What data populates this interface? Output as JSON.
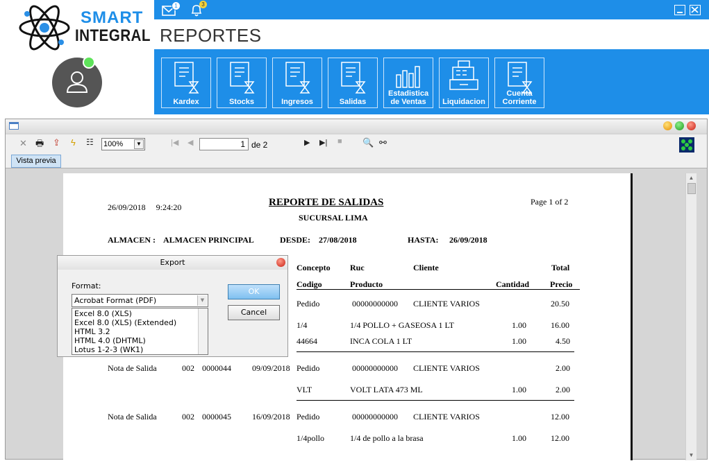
{
  "app": {
    "logo_line1": "SMART",
    "logo_line2": "INTEGRAL",
    "page_title": "REPORTES",
    "mail_count": "1",
    "notif_count": "3",
    "accent": "#1e8ee8"
  },
  "ribbon": [
    {
      "label": "Kardex",
      "icon": "document-hourglass-icon"
    },
    {
      "label": "Stocks",
      "icon": "document-hourglass-icon"
    },
    {
      "label": "Ingresos",
      "icon": "document-hourglass-icon"
    },
    {
      "label": "Salidas",
      "icon": "document-hourglass-icon"
    },
    {
      "label": "Estadistica de Ventas",
      "icon": "bar-chart-icon"
    },
    {
      "label": "Liquidacion",
      "icon": "cash-register-icon"
    },
    {
      "label": "Cuenta Corriente",
      "icon": "document-hourglass-icon"
    }
  ],
  "viewer": {
    "zoom": "100%",
    "page_current": "1",
    "page_of": "de 2",
    "tab_label": "Vista previa"
  },
  "report": {
    "datetime": "26/09/2018     9:24:20",
    "title": "REPORTE DE SALIDAS",
    "subtitle": "SUCURSAL LIMA",
    "page_info": "Page 1 of 2",
    "almacen_label": "ALMACEN :",
    "almacen_value": "ALMACEN PRINCIPAL",
    "desde_label": "DESDE:",
    "desde_value": "27/08/2018",
    "hasta_label": "HASTA:",
    "hasta_value": "26/09/2018",
    "headers": {
      "concepto": "Concepto",
      "ruc": "Ruc",
      "cliente": "Cliente",
      "total": "Total",
      "codigo": "Codigo",
      "producto": "Producto",
      "cantidad": "Cantidad",
      "precio": "Precio"
    },
    "groups": [
      {
        "doc": "",
        "serie": "",
        "numero": "",
        "fecha": "",
        "concepto": "Pedido",
        "ruc": "00000000000",
        "cliente": "CLIENTE VARIOS",
        "total": "20.50",
        "items": [
          {
            "codigo": "1/4",
            "producto": "1/4 POLLO + GASEOSA 1 LT",
            "cantidad": "1.00",
            "precio": "16.00"
          },
          {
            "codigo": "44664",
            "producto": "INCA COLA 1 LT",
            "cantidad": "1.00",
            "precio": "4.50"
          }
        ]
      },
      {
        "doc": "Nota de Salida",
        "serie": "002",
        "numero": "0000044",
        "fecha": "09/09/2018",
        "concepto": "Pedido",
        "ruc": "00000000000",
        "cliente": "CLIENTE VARIOS",
        "total": "2.00",
        "items": [
          {
            "codigo": "VLT",
            "producto": "VOLT LATA 473 ML",
            "cantidad": "1.00",
            "precio": "2.00"
          }
        ]
      },
      {
        "doc": "Nota de Salida",
        "serie": "002",
        "numero": "0000045",
        "fecha": "16/09/2018",
        "concepto": "Pedido",
        "ruc": "00000000000",
        "cliente": "CLIENTE VARIOS",
        "total": "12.00",
        "items": [
          {
            "codigo": "1/4pollo",
            "producto": "1/4 de pollo a la brasa",
            "cantidad": "1.00",
            "precio": "12.00"
          }
        ]
      }
    ]
  },
  "export_dialog": {
    "title": "Export",
    "format_label": "Format:",
    "selected_format": "Acrobat Format (PDF)",
    "options": [
      "Excel 8.0 (XLS)",
      "Excel 8.0 (XLS) (Extended)",
      "HTML 3.2",
      "HTML 4.0 (DHTML)",
      "Lotus 1-2-3 (WK1)"
    ],
    "ok_label": "OK",
    "cancel_label": "Cancel"
  }
}
